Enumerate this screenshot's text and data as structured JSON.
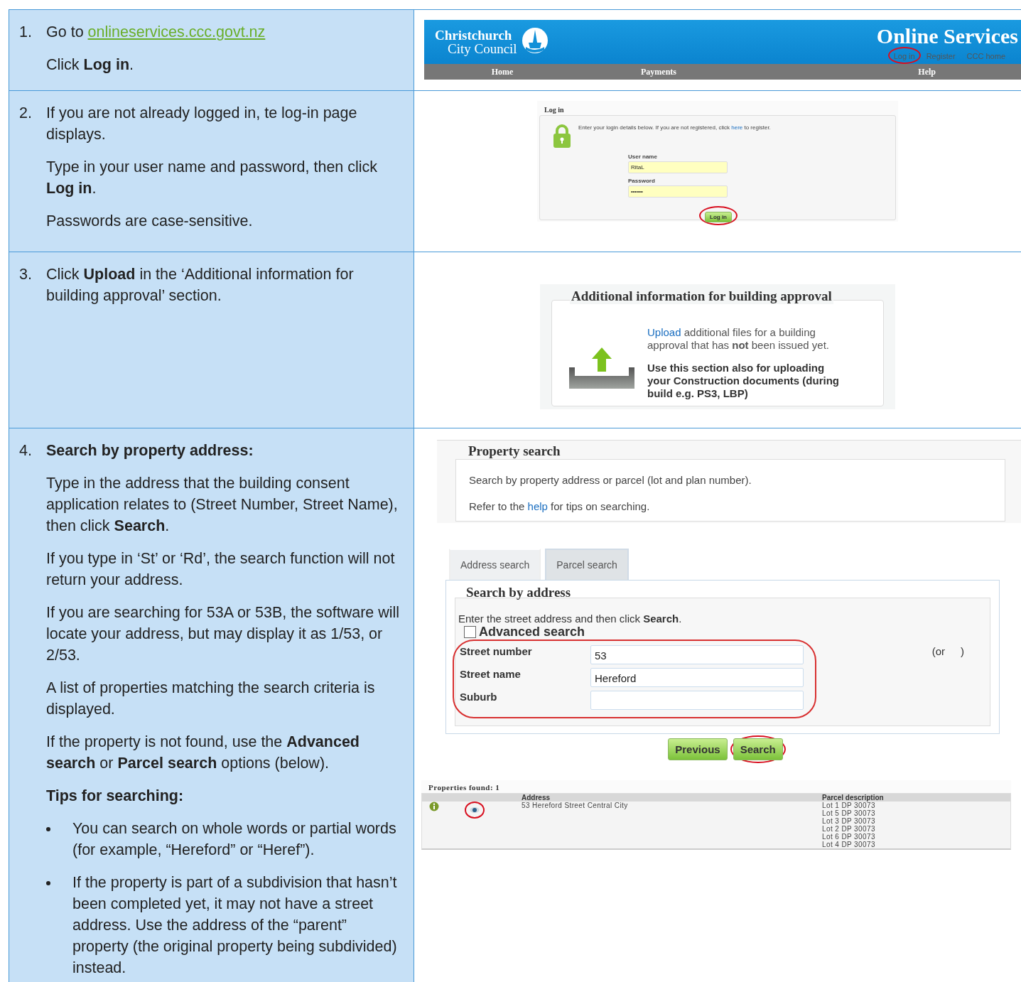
{
  "steps": [
    {
      "number": "1.",
      "paragraphs": [
        {
          "kind": "link_line",
          "text": "Go to",
          "link": "onlineservices.ccc.govt.nz"
        },
        {
          "kind": "text",
          "text": "Click **Log in**."
        }
      ],
      "screenshot": {
        "kind": "site_header",
        "logo_lines": [
          "Christchurch",
          "City Council"
        ],
        "title": "Online Services",
        "links": [
          {
            "label": "Log in",
            "circled": true
          },
          {
            "label": "Register",
            "circled": false
          },
          {
            "label": "CCC home",
            "circled": false
          }
        ],
        "nav": [
          "Home",
          "Payments",
          "Help"
        ]
      }
    },
    {
      "number": "2.",
      "paragraphs": [
        {
          "kind": "text",
          "text": "If you are not already logged in, te log-in page displays."
        },
        {
          "kind": "text",
          "text": "Type in your user name and password, then click **Log in**."
        },
        {
          "kind": "text",
          "text": "Passwords are case-sensitive."
        }
      ],
      "screenshot": {
        "kind": "login",
        "legend": "Log in",
        "intro": "Enter your login details below. If you are not registered, click",
        "link": "here",
        "intro_end": "to register.",
        "fields": [
          {
            "label": "User name",
            "value": "RitaL"
          },
          {
            "label": "Password",
            "value": "••••••"
          }
        ],
        "button": {
          "label": "Log in",
          "circled": true
        }
      }
    },
    {
      "number": "3.",
      "paragraphs": [
        {
          "kind": "text",
          "text": "Click **Upload** in the ‘Additional information for building approval’ section."
        }
      ],
      "screenshot": {
        "kind": "upload",
        "legend": "Additional information for building approval",
        "paragraphs": [
          {
            "link": "Upload",
            "text": "additional files for a building approval that has **not** been issued yet.",
            "bold": false
          },
          {
            "text": "Use this section also for uploading your Construction documents (during build e.g. PS3, LBP)",
            "bold": true
          }
        ]
      }
    },
    {
      "number": "4.",
      "paragraphs": [
        {
          "kind": "heading",
          "text": "Search by property address:"
        },
        {
          "kind": "text",
          "text": "Type in the address that the building consent application relates to (Street Number, Street Name), then click **Search**."
        },
        {
          "kind": "text",
          "text": "If you type in ‘St’ or ‘Rd’, the search function will not return your address."
        },
        {
          "kind": "text",
          "text": "If you are searching for 53A or 53B, the software will locate your address, but may display it as 1/53, or 2/53."
        },
        {
          "kind": "text",
          "text": "A list of properties matching the search criteria is displayed."
        },
        {
          "kind": "text",
          "text": "If the property is not found, use the **Advanced search** or **Parcel search** options (below)."
        },
        {
          "kind": "heading",
          "text": "Tips for searching:"
        },
        {
          "kind": "bullet",
          "text": "You can search on whole words or partial words (for example, “Hereford” or “Heref”)."
        },
        {
          "kind": "bullet",
          "text": "If the property is part of a subdivision that hasn’t been completed yet, it may not have a street address. Use the address of the “parent” property (the original property being subdivided) instead."
        }
      ],
      "screenshot": {
        "kind": "property_search",
        "legend": "Property search",
        "lines": [
          {
            "text": "Search by property address or parcel (lot and plan number)."
          },
          {
            "text": "Refer to the",
            "link": "help",
            "text_end": "for tips on searching."
          }
        ],
        "tabs": [
          {
            "label": "Address search",
            "selected": true
          },
          {
            "label": "Parcel search",
            "selected": false
          }
        ],
        "section": "Search by address",
        "instruction": "Enter the street address and then click **Search**.",
        "advanced": {
          "label": "Advanced search",
          "checked": false
        },
        "fields": [
          {
            "label": "Street number",
            "value": "53"
          },
          {
            "label": "Street name",
            "value": "Hereford"
          },
          {
            "label": "Suburb"
          }
        ],
        "fields_circled": true,
        "aside": "(or",
        "aside_end": ")",
        "buttons": [
          {
            "label": "Previous",
            "circled": false
          },
          {
            "label": "Search",
            "circled": true
          }
        ],
        "results": {
          "legend": "Properties found: 1",
          "columns": [
            "Address",
            "Parcel description"
          ],
          "rows": [
            {
              "address": "53 Hereford Street Central City",
              "view_circled": true,
              "parcels": [
                "Lot 1 DP 30073",
                "Lot 5 DP 30073",
                "Lot 3 DP 30073",
                "Lot 2 DP 30073",
                "Lot 6 DP 30073",
                "Lot 4 DP 30073"
              ]
            }
          ]
        }
      }
    }
  ]
}
